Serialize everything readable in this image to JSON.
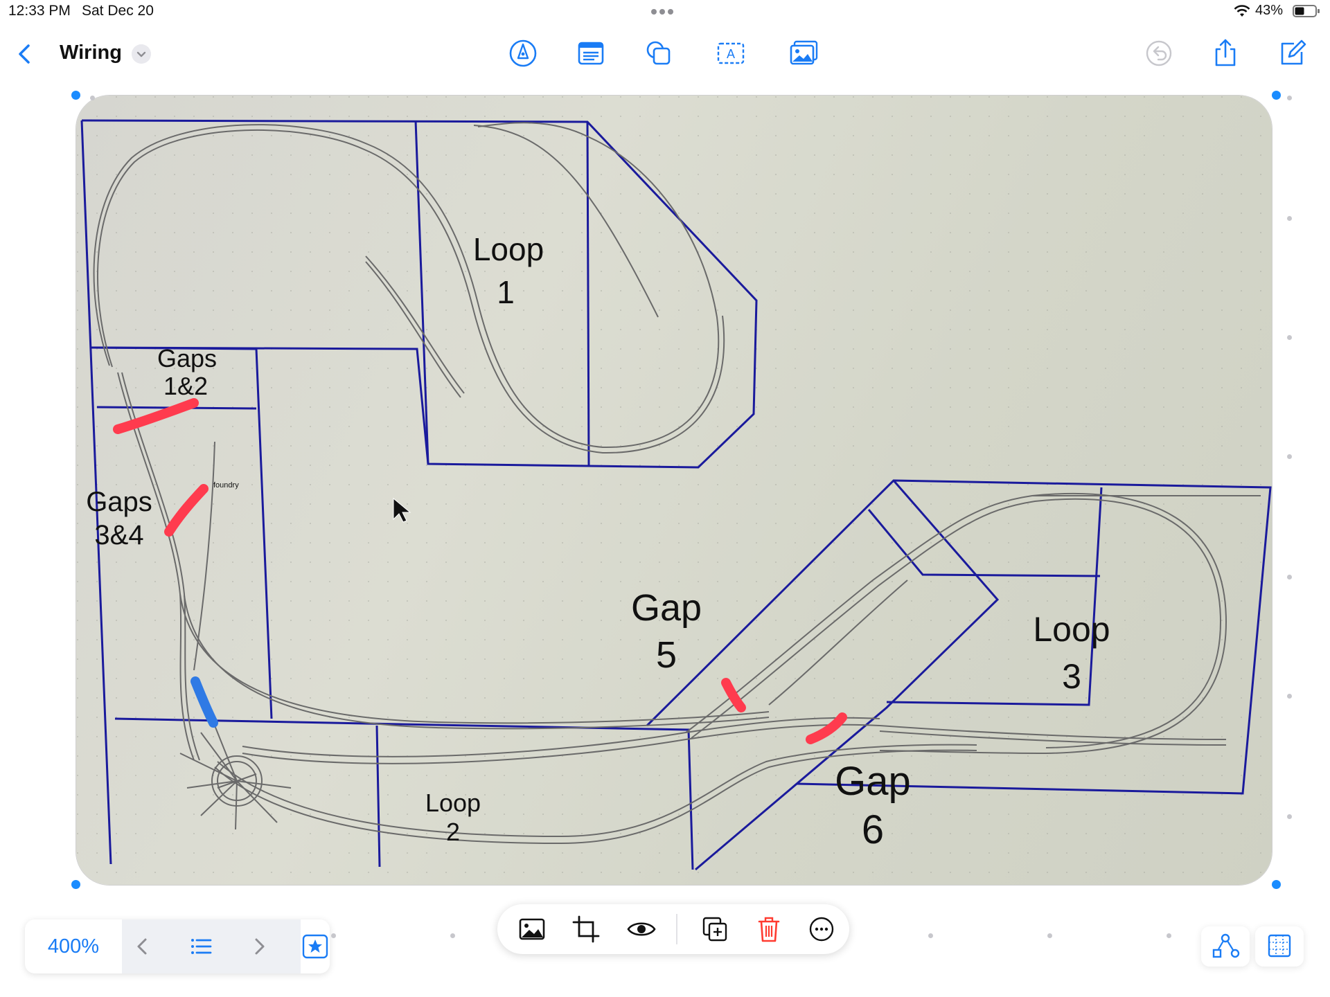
{
  "status_bar": {
    "time": "12:33 PM",
    "date": "Sat Dec 20",
    "battery": "43%"
  },
  "toolbar": {
    "title": "Wiring",
    "tools": [
      "pen-icon",
      "text-box-icon",
      "shapes-icon",
      "text-icon",
      "media-icon"
    ],
    "right_actions": [
      "undo-icon",
      "share-icon",
      "compose-icon"
    ]
  },
  "photo": {
    "labels": {
      "loop1_a": "Loop",
      "loop1_b": "1",
      "gaps12_a": "Gaps",
      "gaps12_b": "1&2",
      "gaps34_a": "Gaps",
      "gaps34_b": "3&4",
      "foundry": "foundry",
      "gap5_a": "Gap",
      "gap5_b": "5",
      "loop3_a": "Loop",
      "loop3_b": "3",
      "loop2_a": "Loop",
      "loop2_b": "2",
      "gap6_a": "Gap",
      "gap6_b": "6"
    },
    "colors": {
      "boundary": "#1a1a9c",
      "track": "#6a6a6a",
      "gap_mark": "#ff3b4e",
      "blue_mark": "#2f7ae5"
    }
  },
  "bottom_bar": {
    "zoom": "400%",
    "action_items": [
      "image-icon",
      "crop-icon",
      "eye-icon",
      "duplicate-icon",
      "trash-icon",
      "more-icon"
    ]
  }
}
